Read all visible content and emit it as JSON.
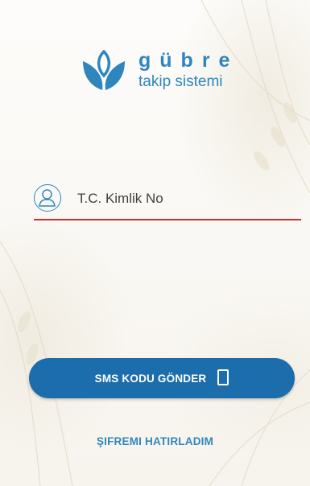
{
  "brand": {
    "word": "gübre",
    "subtitle": "takip sistemi",
    "color": "#2f86bd",
    "icon": "leaf-logo-icon"
  },
  "form": {
    "id_placeholder": "T.C. Kimlik No",
    "id_value": "",
    "user_icon": "user-icon",
    "underline_color": "#d62c2c"
  },
  "actions": {
    "sms_label": "SMS KODU GÖNDER",
    "sms_icon": "mobile-phone-icon",
    "sms_color": "#1c6dab",
    "forgot_label": "ŞIFREMI HATIRLADIM"
  }
}
